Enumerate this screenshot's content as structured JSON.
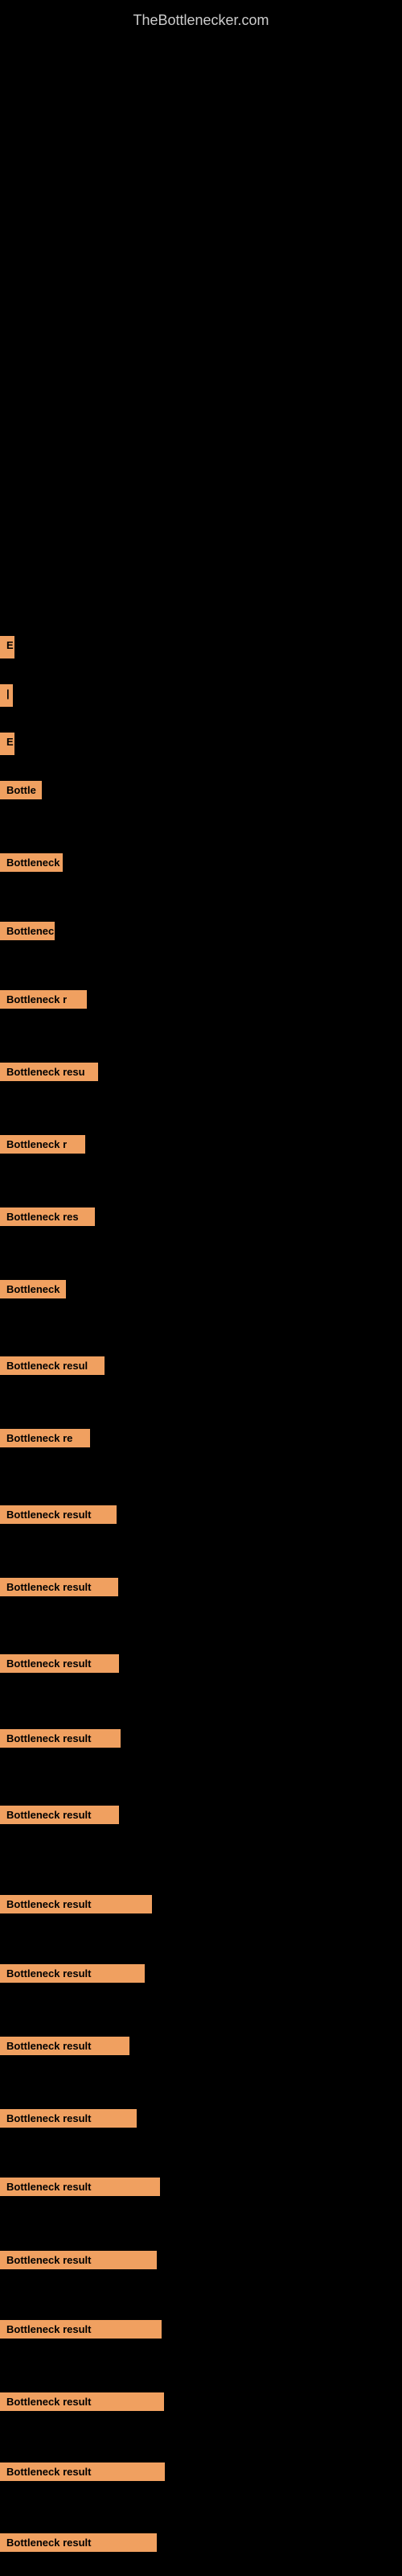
{
  "site": {
    "title": "TheBottlenecker.com"
  },
  "bars": [
    {
      "id": "label-e-1",
      "text": "E",
      "class": "label-e-1"
    },
    {
      "id": "label-pipe",
      "text": "|",
      "class": "label-pipe"
    },
    {
      "id": "label-e-2",
      "text": "E",
      "class": "label-e-2"
    },
    {
      "id": "bar-1",
      "text": "Bottle",
      "class": "bar-1"
    },
    {
      "id": "bar-2",
      "text": "Bottleneck",
      "class": "bar-2"
    },
    {
      "id": "bar-3",
      "text": "Bottlenec",
      "class": "bar-3"
    },
    {
      "id": "bar-4",
      "text": "Bottleneck r",
      "class": "bar-4"
    },
    {
      "id": "bar-5",
      "text": "Bottleneck resu",
      "class": "bar-5"
    },
    {
      "id": "bar-6",
      "text": "Bottleneck r",
      "class": "bar-6"
    },
    {
      "id": "bar-7",
      "text": "Bottleneck res",
      "class": "bar-7"
    },
    {
      "id": "bar-8",
      "text": "Bottleneck",
      "class": "bar-8"
    },
    {
      "id": "bar-9",
      "text": "Bottleneck resul",
      "class": "bar-9"
    },
    {
      "id": "bar-10",
      "text": "Bottleneck re",
      "class": "bar-10"
    },
    {
      "id": "bar-11",
      "text": "Bottleneck result",
      "class": "bar-11"
    },
    {
      "id": "bar-12",
      "text": "Bottleneck result",
      "class": "bar-12"
    },
    {
      "id": "bar-13",
      "text": "Bottleneck result",
      "class": "bar-13"
    },
    {
      "id": "bar-14",
      "text": "Bottleneck result",
      "class": "bar-14"
    },
    {
      "id": "bar-15",
      "text": "Bottleneck result",
      "class": "bar-15"
    },
    {
      "id": "bar-16",
      "text": "Bottleneck result",
      "class": "bar-16"
    },
    {
      "id": "bar-17",
      "text": "Bottleneck result",
      "class": "bar-17"
    },
    {
      "id": "bar-18",
      "text": "Bottleneck result",
      "class": "bar-18"
    },
    {
      "id": "bar-19",
      "text": "Bottleneck result",
      "class": "bar-19"
    },
    {
      "id": "bar-20",
      "text": "Bottleneck result",
      "class": "bar-20"
    },
    {
      "id": "bar-21",
      "text": "Bottleneck result",
      "class": "bar-21"
    },
    {
      "id": "bar-22",
      "text": "Bottleneck result",
      "class": "bar-22"
    },
    {
      "id": "bar-23",
      "text": "Bottleneck result",
      "class": "bar-23"
    },
    {
      "id": "bar-24",
      "text": "Bottleneck result",
      "class": "bar-24"
    },
    {
      "id": "bar-25",
      "text": "Bottleneck result",
      "class": "bar-25"
    }
  ]
}
